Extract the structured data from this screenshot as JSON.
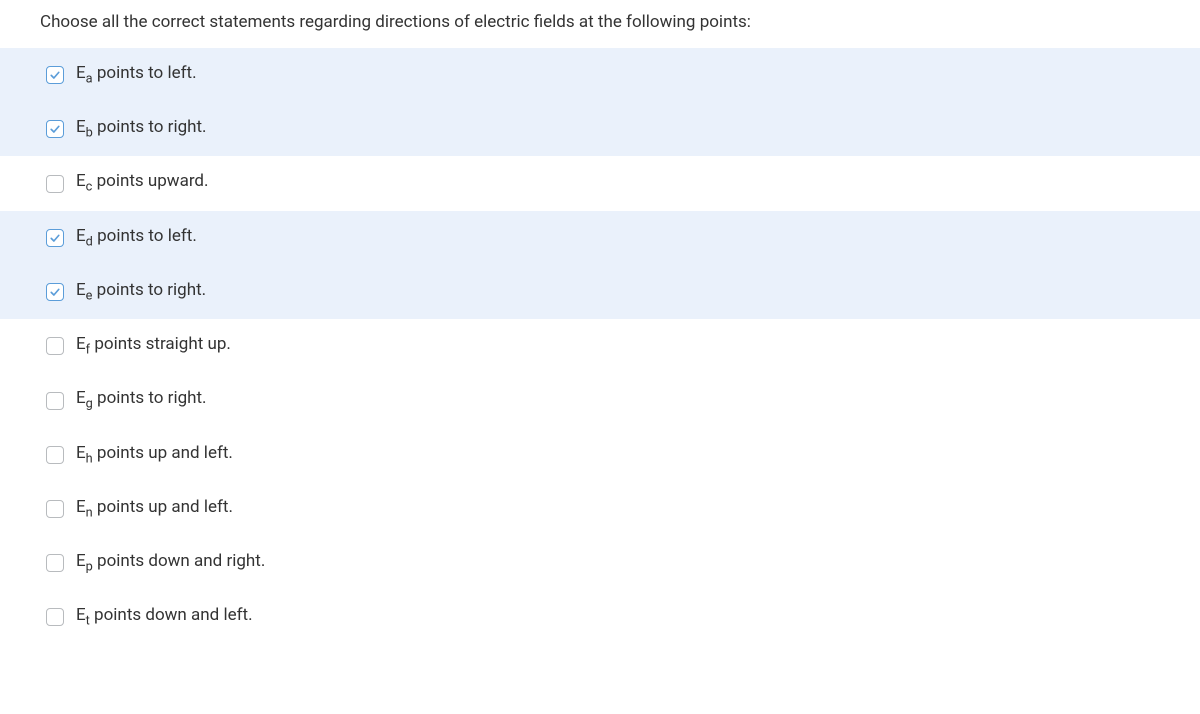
{
  "question": "Choose all the correct statements regarding directions of electric fields at the following points:",
  "options": [
    {
      "var": "E",
      "sub": "a",
      "rest": " points to left.",
      "checked": true
    },
    {
      "var": "E",
      "sub": "b",
      "rest": " points to right.",
      "checked": true
    },
    {
      "var": "E",
      "sub": "c",
      "rest": " points upward.",
      "checked": false
    },
    {
      "var": "E",
      "sub": "d",
      "rest": " points to left.",
      "checked": true
    },
    {
      "var": "E",
      "sub": "e",
      "rest": " points to right.",
      "checked": true
    },
    {
      "var": "E",
      "sub": "f",
      "rest": " points straight up.",
      "checked": false
    },
    {
      "var": "E",
      "sub": "g",
      "rest": " points to right.",
      "checked": false
    },
    {
      "var": "E",
      "sub": "h",
      "rest": " points up and left.",
      "checked": false
    },
    {
      "var": "E",
      "sub": "n",
      "rest": " points up and left.",
      "checked": false
    },
    {
      "var": "E",
      "sub": "p",
      "rest": " points down and right.",
      "checked": false
    },
    {
      "var": "E",
      "sub": "t",
      "rest": " points down and left.",
      "checked": false
    }
  ]
}
